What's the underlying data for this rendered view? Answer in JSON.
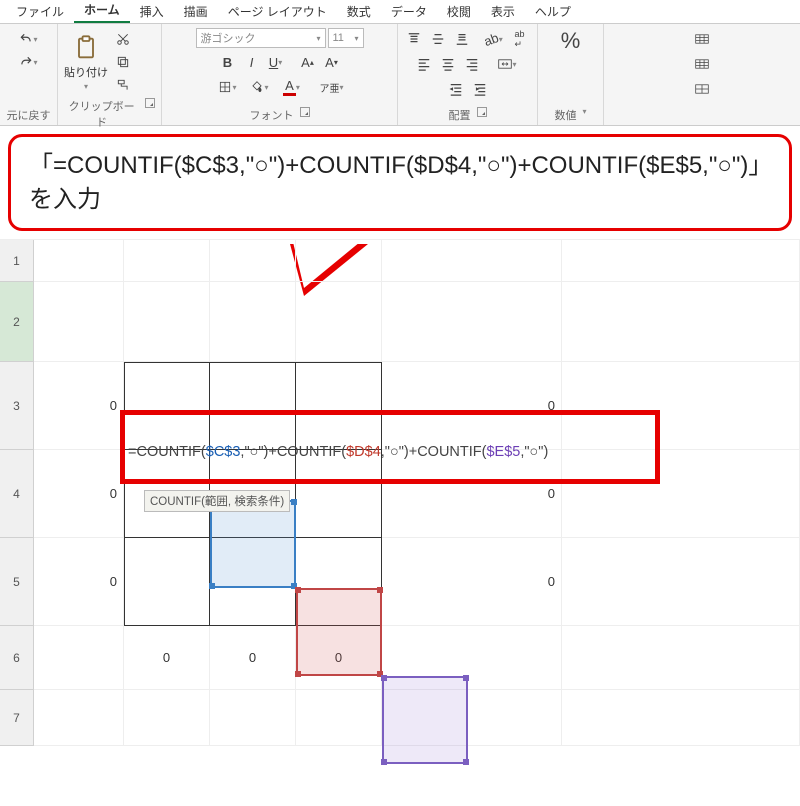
{
  "tabs": {
    "file": "ファイル",
    "home": "ホーム",
    "insert": "挿入",
    "draw": "描画",
    "layout": "ページ レイアウト",
    "formulas": "数式",
    "data": "データ",
    "review": "校閲",
    "view": "表示",
    "help": "ヘルプ"
  },
  "ribbon": {
    "undo_label": "元に戻す",
    "clipboard_label": "クリップボード",
    "paste_label": "貼り付け",
    "font_label": "フォント",
    "font_name": "游ゴシック",
    "font_size": "11",
    "align_label": "配置",
    "number_label": "数値"
  },
  "callout_text": "「=COUNTIF($C$3,\"○\")+COUNTIF($D$4,\"○\")+COUNTIF($E$5,\"○\")」を入力",
  "formula": {
    "eq": "=",
    "fn": "COUNTIF",
    "open": "(",
    "close": ")",
    "ref1": "$C$3",
    "ref2": "$D$4",
    "ref3": "$E$5",
    "arg": ",\"○\"",
    "plus": "+"
  },
  "tooltip": "COUNTIF(範囲, 検索条件)",
  "row_heads": {
    "r1": "1",
    "r2": "2",
    "r3": "3",
    "r4": "4",
    "r5": "5",
    "r6": "6",
    "r7": "7"
  },
  "values": {
    "b3": "0",
    "f3": "0",
    "b4": "0",
    "f4": "0",
    "b5": "0",
    "f5": "0",
    "c6": "0",
    "d6": "0",
    "e6": "0"
  }
}
